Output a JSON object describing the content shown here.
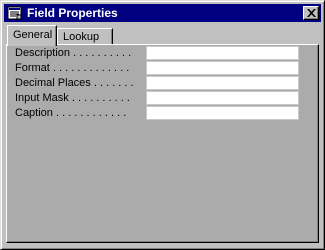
{
  "window": {
    "title": "Field Properties"
  },
  "tabs": [
    {
      "label": "General",
      "active": true
    },
    {
      "label": "Lookup",
      "active": false
    }
  ],
  "fields": [
    {
      "label": "Description . . . . . . . . . .",
      "value": ""
    },
    {
      "label": "Format . . . . . . . . . . . . .",
      "value": ""
    },
    {
      "label": "Decimal Places . . . . . . .",
      "value": ""
    },
    {
      "label": "Input Mask . . . . . . . . . .",
      "value": ""
    },
    {
      "label": "Caption . . . . . . . . . . . .",
      "value": ""
    }
  ],
  "icons": {
    "window": "properties-icon",
    "close": "close-icon"
  },
  "colors": {
    "titlebar": "#000080",
    "panel": "#ababab",
    "window": "#c0c0c0"
  }
}
